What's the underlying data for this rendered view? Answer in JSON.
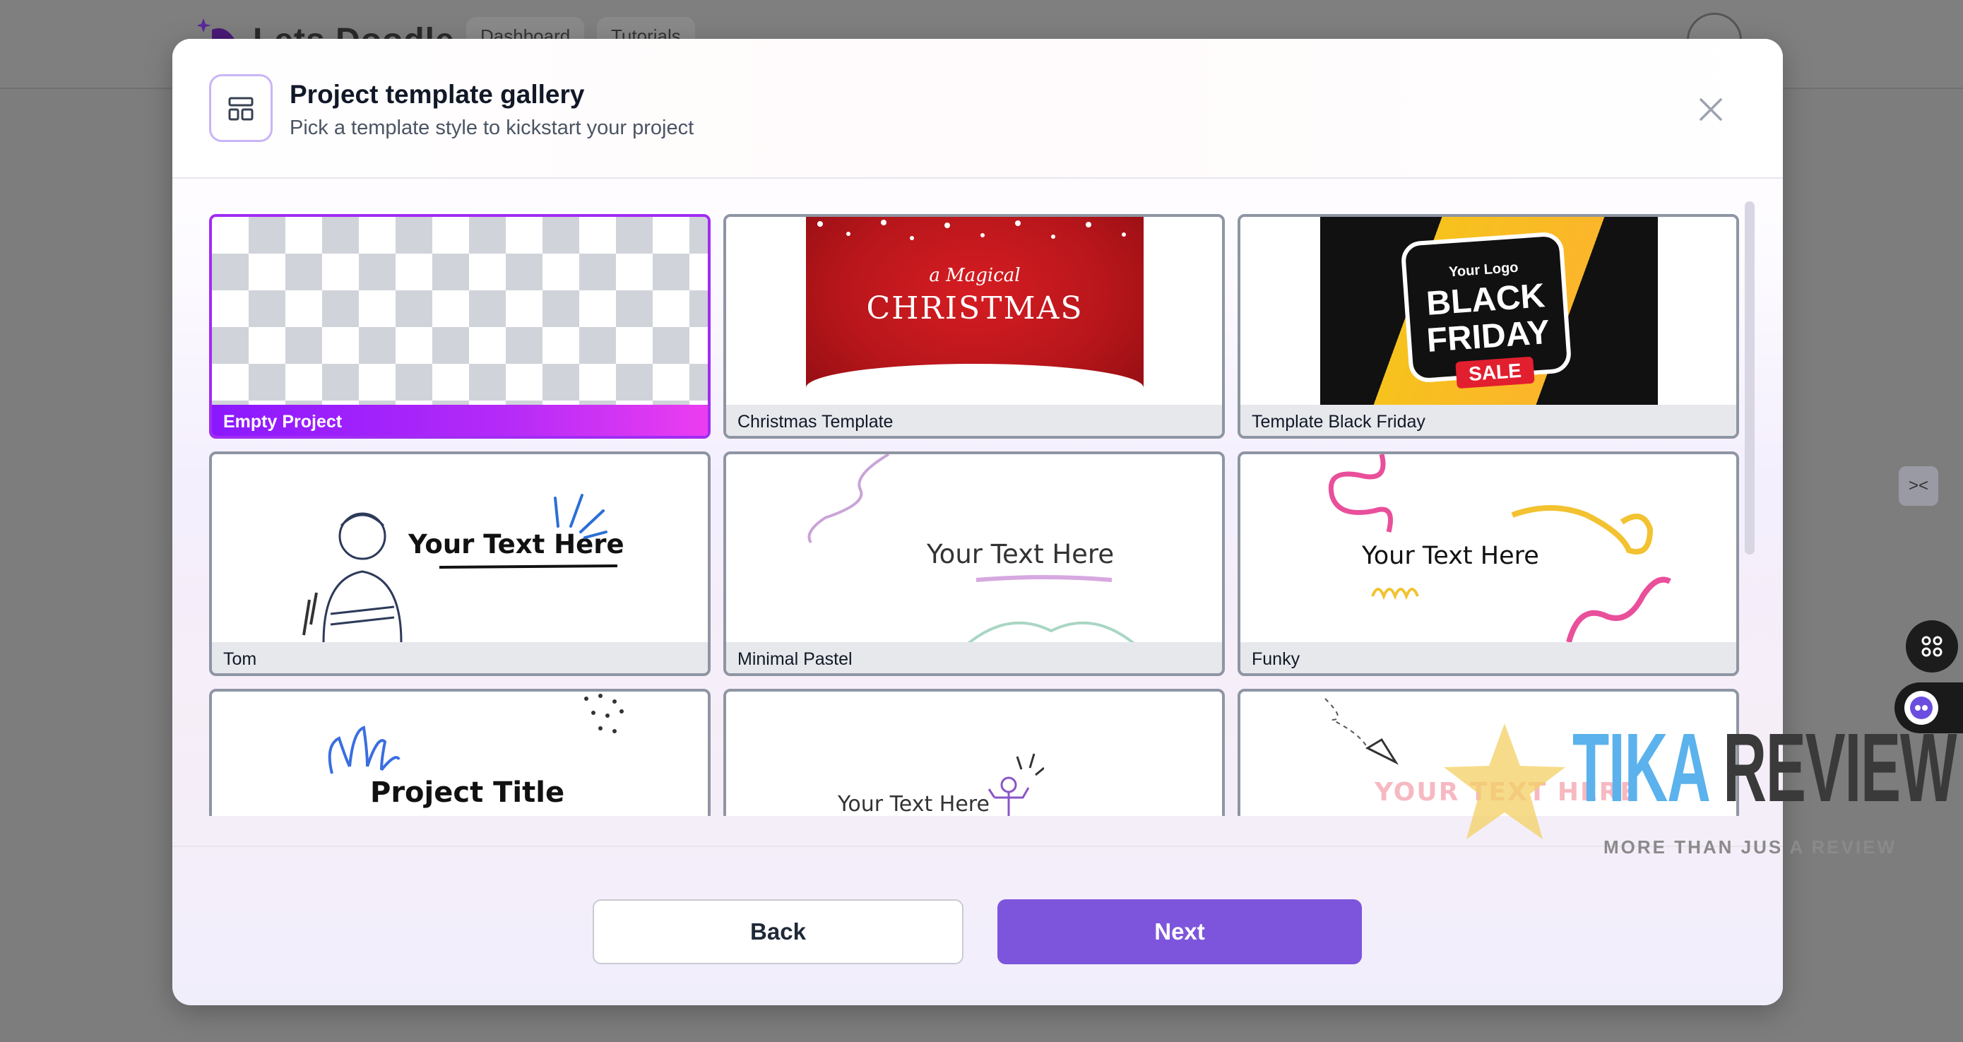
{
  "background": {
    "brand": "Lets Doodle",
    "tabs": [
      "Dashboard",
      "Tutorials"
    ]
  },
  "modal": {
    "title": "Project template gallery",
    "subtitle": "Pick a template style to kickstart your project",
    "templates": [
      {
        "label": "Empty Project",
        "selected": true
      },
      {
        "label": "Christmas Template",
        "selected": false,
        "thumb_small": "a Magical",
        "thumb_big": "CHRISTMAS"
      },
      {
        "label": "Template Black Friday",
        "selected": false,
        "thumb_logo": "Your Logo",
        "thumb_big": "BLACK FRIDAY",
        "thumb_sale": "SALE"
      },
      {
        "label": "Tom",
        "selected": false,
        "thumb_text": "Your Text Here"
      },
      {
        "label": "Minimal Pastel",
        "selected": false,
        "thumb_text": "Your Text Here"
      },
      {
        "label": "Funky",
        "selected": false,
        "thumb_text": "Your Text Here"
      },
      {
        "thumb_text": "Project Title"
      },
      {
        "thumb_text": "Your Text Here"
      },
      {
        "thumb_text": "YOUR TEXT HERE"
      }
    ],
    "back_label": "Back",
    "next_label": "Next"
  },
  "watermark": {
    "tika": "TIKA",
    "review": "REVIEW",
    "tagline": "MORE THAN JUS A REVIEW"
  },
  "colors": {
    "accent": "#7d55dc",
    "selected_gradient_start": "#8b18ff",
    "selected_gradient_end": "#ec3df0"
  }
}
